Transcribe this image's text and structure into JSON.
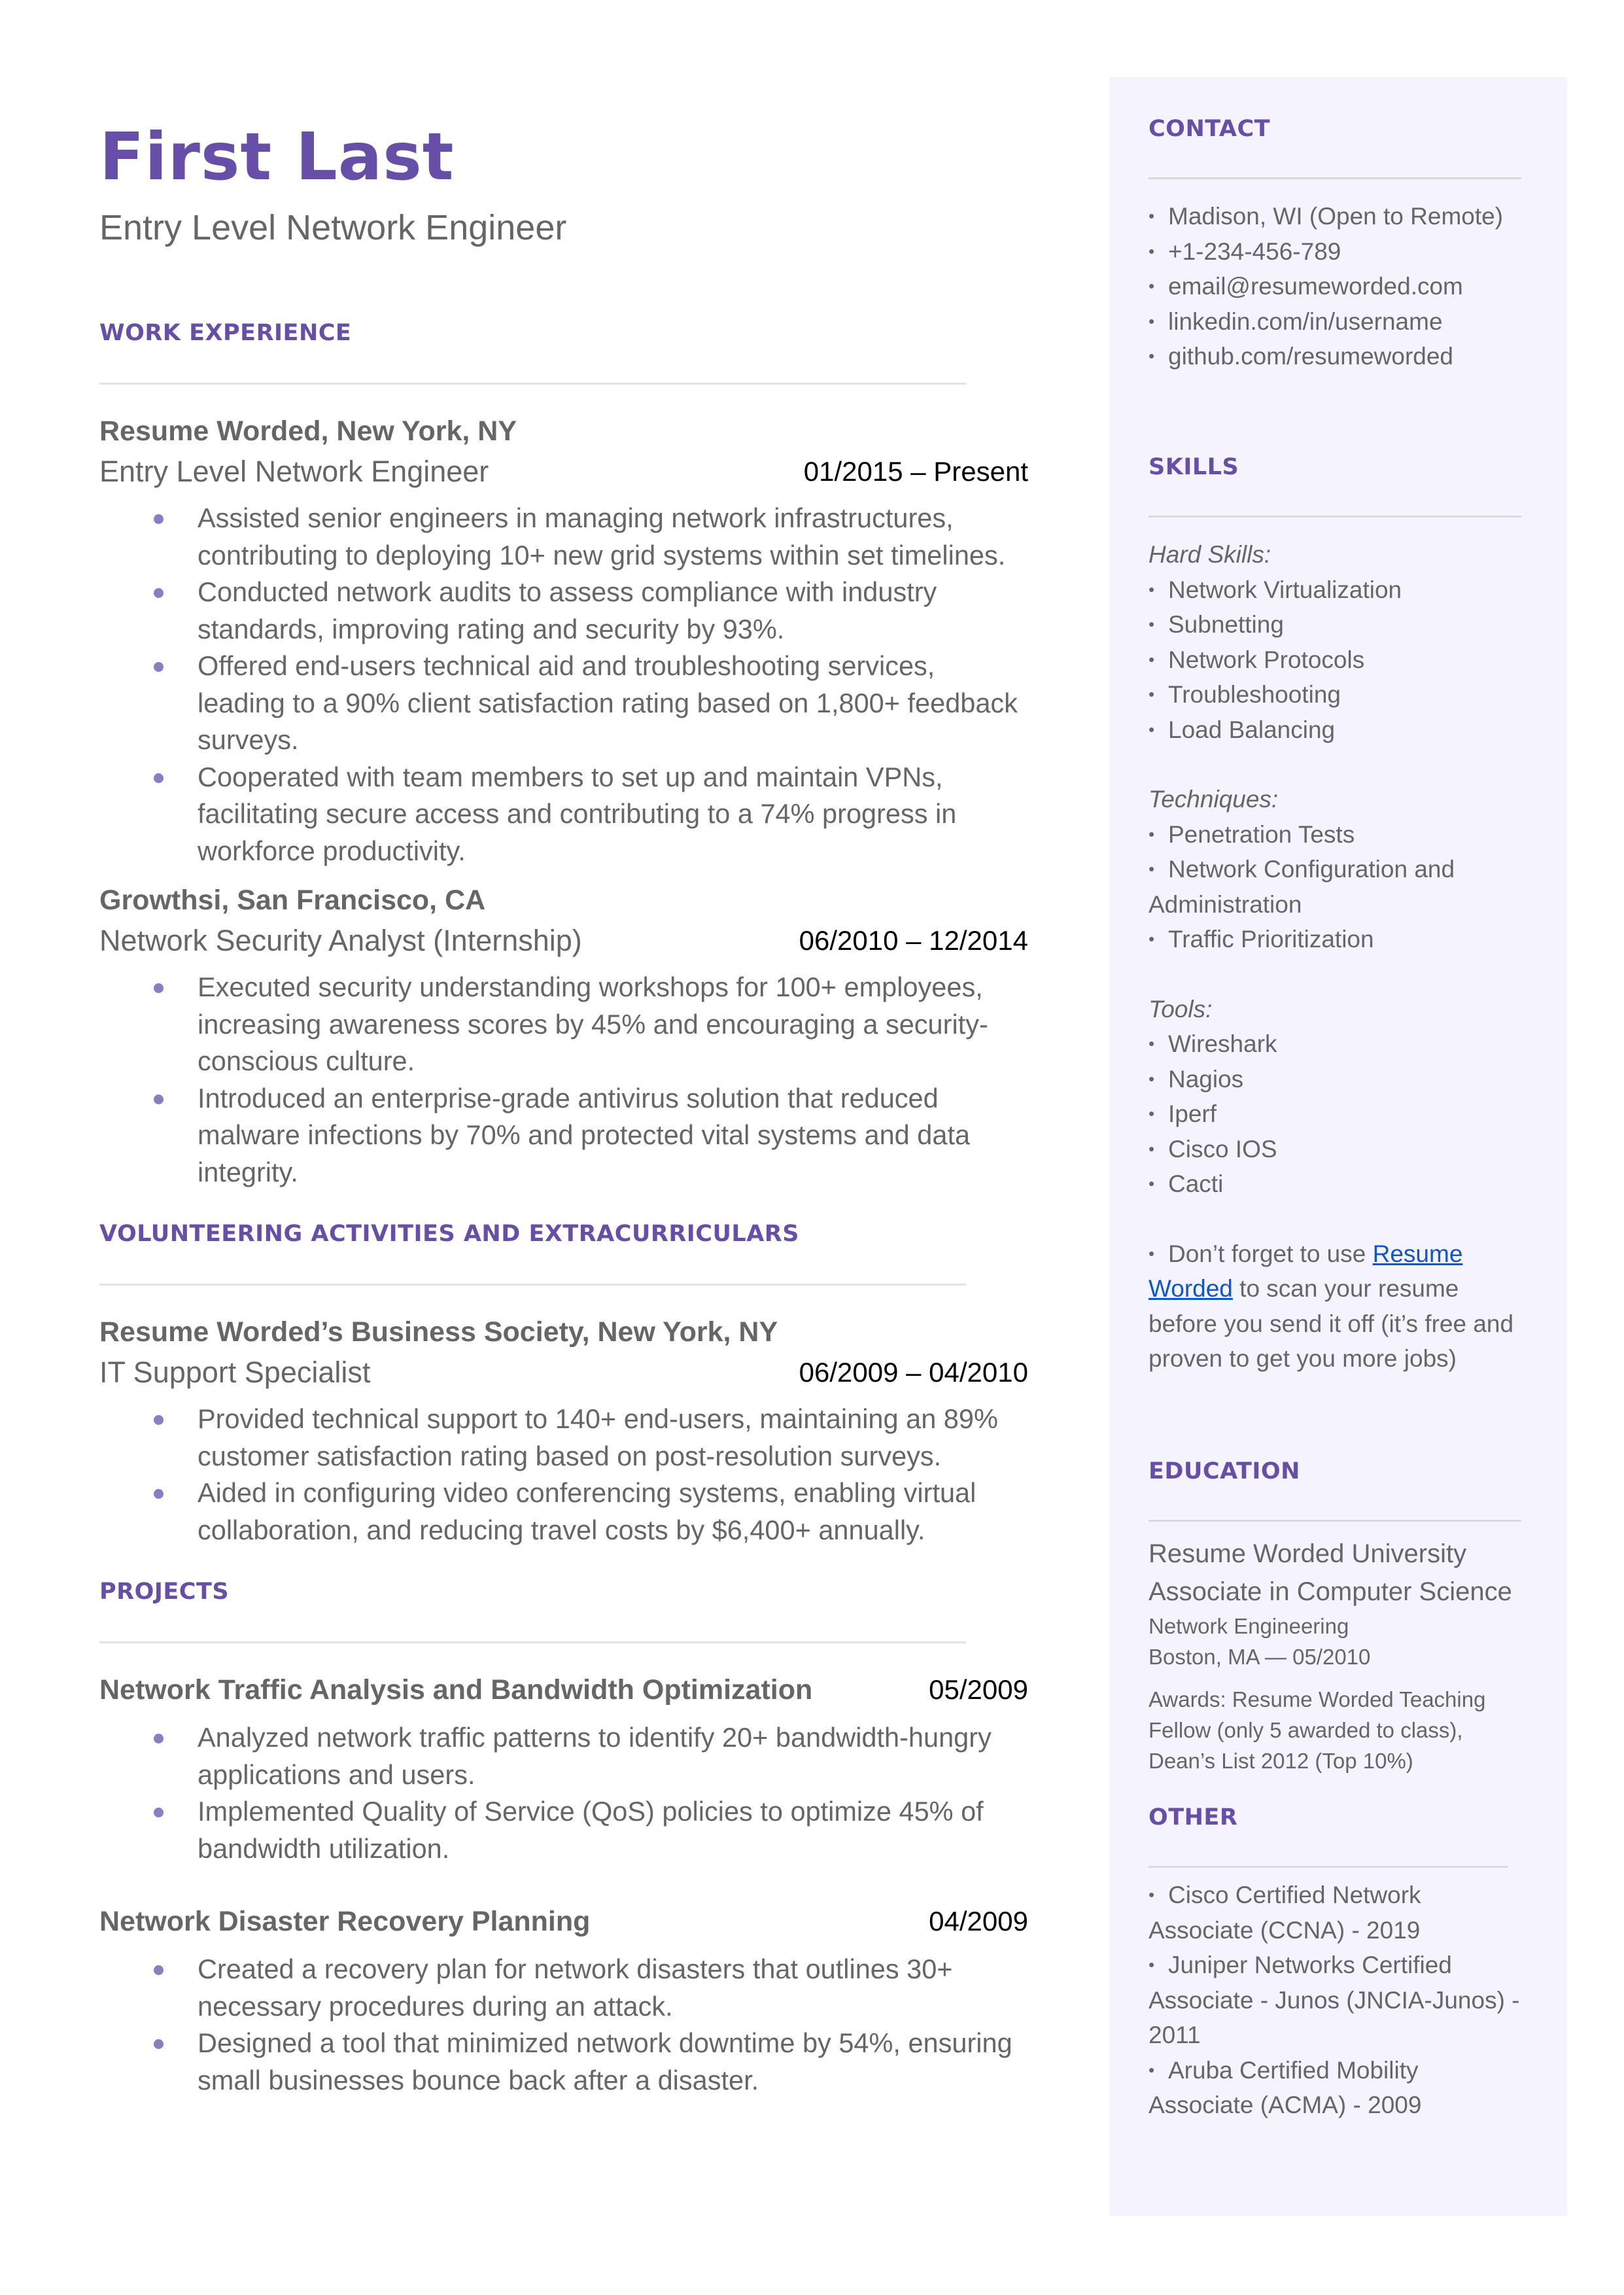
{
  "header": {
    "name": "First Last",
    "headline": "Entry Level Network Engineer"
  },
  "colors": {
    "accent": "#674ea7",
    "bullet": "#8e7cc3",
    "sidebar_bg": "#f5f3fe",
    "text": "#666666",
    "link": "#1155cc"
  },
  "work": {
    "title": "WORK EXPERIENCE",
    "entries": [
      {
        "org": "Resume Worded, New York, NY",
        "role": "Entry Level Network Engineer",
        "dates": "01/2015 – Present",
        "bullets": [
          "Assisted senior engineers in managing network infrastructures, contributing to deploying 10+ new grid systems within set timelines.",
          "Conducted network audits to assess compliance with industry standards, improving rating and security by 93%.",
          "Offered end-users technical aid and troubleshooting services, leading to a 90% client satisfaction rating based on 1,800+ feedback surveys.",
          "Cooperated with team members to set up and maintain VPNs, facilitating secure access and contributing to a 74% progress in workforce productivity."
        ]
      },
      {
        "org": "Growthsi, San Francisco, CA",
        "role": "Network Security Analyst (Internship)",
        "dates": "06/2010 – 12/2014",
        "bullets": [
          "Executed security understanding workshops for 100+ employees, increasing awareness scores by 45% and encouraging a security-conscious culture.",
          "Introduced an enterprise-grade antivirus solution that reduced malware infections by 70% and protected vital systems and data integrity."
        ]
      }
    ]
  },
  "volunteering": {
    "title": "VOLUNTEERING ACTIVITIES AND EXTRACURRICULARS",
    "entries": [
      {
        "org": "Resume Worded’s Business Society, New York, NY",
        "role": "IT Support Specialist",
        "dates": "06/2009 – 04/2010",
        "bullets": [
          "Provided technical support to 140+ end-users, maintaining an 89% customer satisfaction rating based on post-resolution surveys.",
          "Aided in configuring video conferencing systems, enabling virtual collaboration, and reducing travel costs by $6,400+ annually."
        ]
      }
    ]
  },
  "projects": {
    "title": "PROJECTS",
    "entries": [
      {
        "name": "Network Traffic Analysis and Bandwidth Optimization",
        "date": "05/2009",
        "bullets": [
          "Analyzed network traffic patterns to identify 20+ bandwidth-hungry applications and users.",
          "Implemented Quality of Service (QoS) policies to optimize 45% of bandwidth utilization."
        ]
      },
      {
        "name": "Network Disaster Recovery Planning",
        "date": "04/2009",
        "bullets": [
          "Created a recovery plan for network disasters that outlines 30+ necessary procedures during an attack.",
          "Designed a tool that minimized network downtime by 54%, ensuring small businesses bounce back after a disaster."
        ]
      }
    ]
  },
  "sidebar": {
    "contact": {
      "title": "CONTACT",
      "items": [
        "Madison, WI (Open to Remote)",
        "+1-234-456-789",
        "email@resumeworded.com",
        "linkedin.com/in/username",
        "github.com/resumeworded"
      ]
    },
    "skills": {
      "title": "SKILLS",
      "groups": [
        {
          "label": "Hard Skills:",
          "items": [
            "Network Virtualization",
            "Subnetting",
            "Network Protocols",
            "Troubleshooting",
            "Load Balancing"
          ]
        },
        {
          "label": "Techniques:",
          "items": [
            "Penetration Tests",
            "Network Configuration and Administration",
            "Traffic Prioritization"
          ]
        },
        {
          "label": "Tools:",
          "items": [
            "Wireshark",
            "Nagios",
            "Iperf",
            "Cisco IOS",
            "Cacti"
          ]
        }
      ],
      "tip": {
        "prefix": "Don’t forget to use ",
        "link_text": "Resume Worded",
        "suffix": " to scan your resume before you send it off (it’s free and proven to get you more jobs)"
      }
    },
    "education": {
      "title": "EDUCATION",
      "school": "Resume Worded University",
      "degree": "Associate in Computer Science",
      "field": "Network Engineering",
      "location_date": "Boston, MA — 05/2010",
      "awards": "Awards: Resume Worded Teaching Fellow (only 5 awarded to class), Dean’s List 2012 (Top 10%)"
    },
    "other": {
      "title": "OTHER",
      "items": [
        "Cisco Certified Network Associate (CCNA) - 2019",
        "Juniper Networks Certified Associate - Junos (JNCIA-Junos) - 2011",
        "Aruba Certified Mobility Associate (ACMA) - 2009"
      ]
    }
  }
}
